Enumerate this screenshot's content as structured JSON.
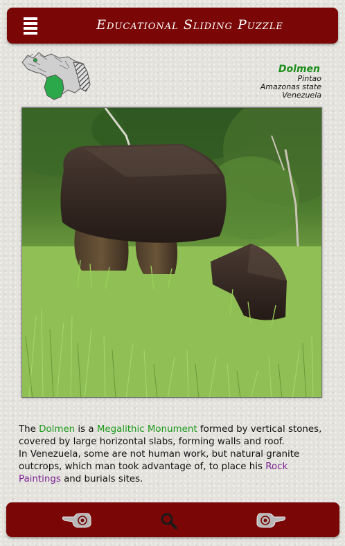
{
  "header": {
    "title": "Educational Sliding Puzzle",
    "menu_icon": "hamburger-menu-icon"
  },
  "location": {
    "name": "Dolmen",
    "place": "Pintao",
    "state": "Amazonas state",
    "country": "Venezuela"
  },
  "map": {
    "icon": "venezuela-map-icon",
    "highlight_color": "#2aa84a"
  },
  "photo": {
    "subject": "dolmen-photo"
  },
  "description": {
    "p1": "The ",
    "dolmen": "Dolmen",
    "p2": " is a ",
    "monument": "Megalithic Monument",
    "p3": " formed by vertical stones, covered by large horizontal slabs, forming walls and roof.",
    "p4": "In Venezuela, some are not human work, but natural granite outcrops, which man took advantage of, to place his ",
    "rock": "Rock Paintings",
    "p5": " and burials sites."
  },
  "footer": {
    "prev_icon": "pointing-hand-left-icon",
    "zoom_icon": "magnifier-icon",
    "next_icon": "pointing-hand-right-icon"
  },
  "colors": {
    "bar": "#7a0606",
    "link_green": "#1b9a1b",
    "link_purple": "#7a2090"
  }
}
